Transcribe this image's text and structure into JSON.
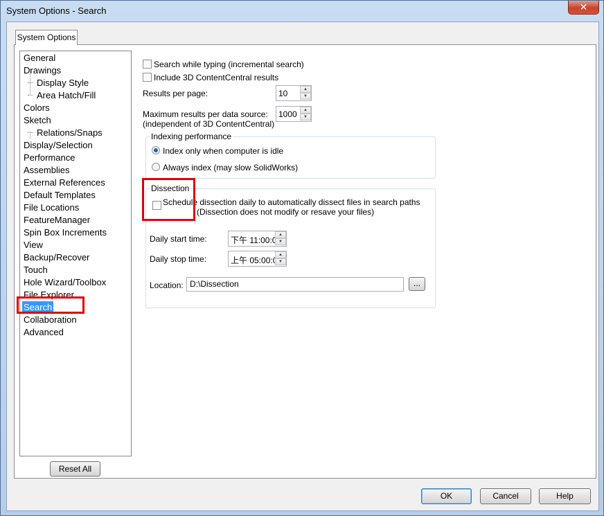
{
  "window": {
    "title": "System Options - Search",
    "close_glyph": "✕"
  },
  "tab": {
    "label": "System Options"
  },
  "tree": {
    "items": [
      {
        "label": "General"
      },
      {
        "label": "Drawings"
      },
      {
        "label": "Display Style"
      },
      {
        "label": "Area Hatch/Fill"
      },
      {
        "label": "Colors"
      },
      {
        "label": "Sketch"
      },
      {
        "label": "Relations/Snaps"
      },
      {
        "label": "Display/Selection"
      },
      {
        "label": "Performance"
      },
      {
        "label": "Assemblies"
      },
      {
        "label": "External References"
      },
      {
        "label": "Default Templates"
      },
      {
        "label": "File Locations"
      },
      {
        "label": "FeatureManager"
      },
      {
        "label": "Spin Box Increments"
      },
      {
        "label": "View"
      },
      {
        "label": "Backup/Recover"
      },
      {
        "label": "Touch"
      },
      {
        "label": "Hole Wizard/Toolbox"
      },
      {
        "label": "File Explorer"
      },
      {
        "label": "Search"
      },
      {
        "label": "Collaboration"
      },
      {
        "label": "Advanced"
      }
    ],
    "selected": "Search",
    "reset_label": "Reset All"
  },
  "options": {
    "search_while_typing": "Search while typing (incremental search)",
    "include_3d_cc": "Include 3D ContentCentral results",
    "results_per_page_label": "Results per page:",
    "results_per_page_value": "10",
    "max_results_label_1": "Maximum results per data source:",
    "max_results_label_2": "(independent of 3D ContentCentral)",
    "max_results_value": "1000"
  },
  "indexing": {
    "title": "Indexing performance",
    "idle_label": "Index only when computer is idle",
    "always_label": "Always index (may slow SolidWorks)",
    "selected": "idle"
  },
  "dissection": {
    "title": "Dissection",
    "schedule_label_1": "Schedule dissection daily to automatically dissect files in search paths",
    "schedule_label_2": "(Dissection does not modify or resave your files)",
    "start_label": "Daily start time:",
    "start_value": "下午 11:00:0",
    "stop_label": "Daily stop time:",
    "stop_value": "上午 05:00:0",
    "location_label": "Location:",
    "location_value": "D:\\Dissection",
    "browse_label": "..."
  },
  "footer": {
    "ok_label": "OK",
    "cancel_label": "Cancel",
    "help_label": "Help"
  },
  "colors": {
    "selection": "#3399ff",
    "highlight_box": "#e00000"
  }
}
